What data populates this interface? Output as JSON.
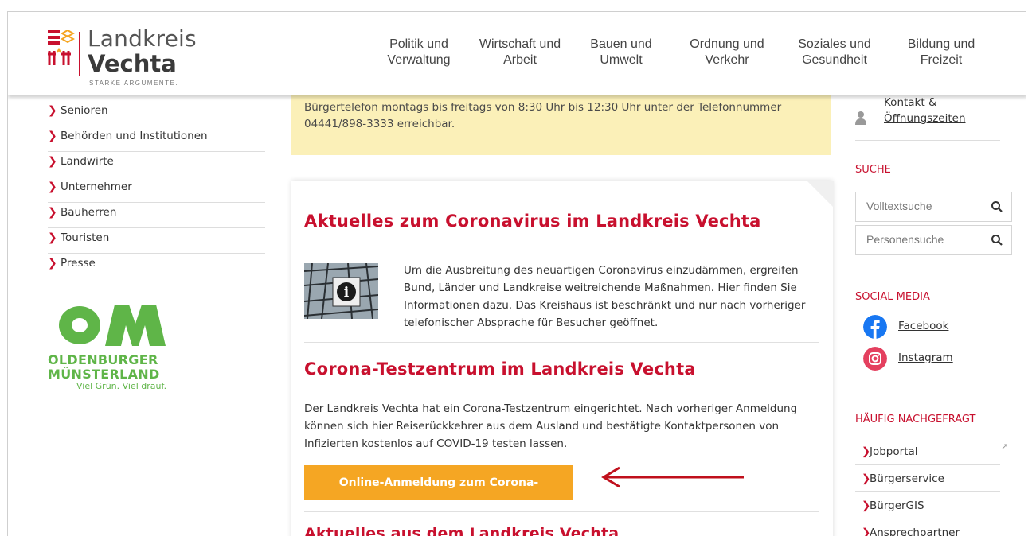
{
  "header": {
    "logo": {
      "line1": "Landkreis",
      "line2": "Vechta",
      "tagline": "STARKE ARGUMENTE."
    },
    "nav": [
      {
        "line1": "Politik und",
        "line2": "Verwaltung"
      },
      {
        "line1": "Wirtschaft und",
        "line2": "Arbeit"
      },
      {
        "line1": "Bauen und",
        "line2": "Umwelt"
      },
      {
        "line1": "Ordnung und",
        "line2": "Verkehr"
      },
      {
        "line1": "Soziales und",
        "line2": "Gesundheit"
      },
      {
        "line1": "Bildung und",
        "line2": "Freizeit"
      }
    ]
  },
  "sidebar": {
    "items": [
      {
        "label": "Senioren"
      },
      {
        "label": "Behörden und Institutionen"
      },
      {
        "label": "Landwirte"
      },
      {
        "label": "Unternehmer"
      },
      {
        "label": "Bauherren"
      },
      {
        "label": "Touristen"
      },
      {
        "label": "Presse"
      }
    ],
    "om": {
      "letters": "OM",
      "line1": "OLDENBURGER",
      "line2": "MÜNSTERLAND",
      "slogan": "Viel Grün. Viel drauf."
    }
  },
  "notice": {
    "text": "Bürgertelefon montags bis freitags von 8:30 Uhr bis 12:30 Uhr unter der Telefonnummer 04441/898-3333 erreichbar."
  },
  "main": {
    "section1": {
      "title": "Aktuelles zum Coronavirus im Landkreis Vechta",
      "text": "Um die Ausbreitung des neuartigen Coronavirus einzudämmen, ergreifen Bund, Länder und Landkreise weitreichende Maßnahmen. Hier finden Sie Informationen dazu. Das Kreishaus ist beschränkt und nur nach vorheriger telefonischer Absprache für Besucher geöffnet."
    },
    "section2": {
      "title": "Corona-Testzentrum im Landkreis Vechta",
      "text": "Der Landkreis Vechta hat ein Corona-Testzentrum eingerichtet. Nach vorheriger Anmeldung können sich hier Reiserückkehrer aus dem Ausland und bestätigte Kontaktpersonen von Infizierten kostenlos auf COVID-19 testen lassen.",
      "cta": "Online-Anmeldung zum Corona-Testzentrum"
    },
    "section3": {
      "title": "Aktuelles aus dem Landkreis Vechta"
    }
  },
  "right": {
    "contact": {
      "line1": "Kontakt &",
      "line2": "Öffnungszeiten"
    },
    "search_heading": "SUCHE",
    "search1_placeholder": "Volltextsuche",
    "search2_placeholder": "Personensuche",
    "social_heading": "SOCIAL MEDIA",
    "social": [
      {
        "label": "Facebook"
      },
      {
        "label": "Instagram"
      }
    ],
    "faq_heading": "HÄUFIG NACHGEFRAGT",
    "faq": [
      {
        "label": "Jobportal"
      },
      {
        "label": "Bürgerservice"
      },
      {
        "label": "BürgerGIS"
      },
      {
        "label": "Ansprechpartner"
      }
    ]
  },
  "colors": {
    "accent": "#c8102e",
    "cta": "#f5a623",
    "notice_bg": "#fbf0b8",
    "om_green": "#5fb548",
    "facebook": "#1877f2",
    "instagram": "#e4405f"
  }
}
